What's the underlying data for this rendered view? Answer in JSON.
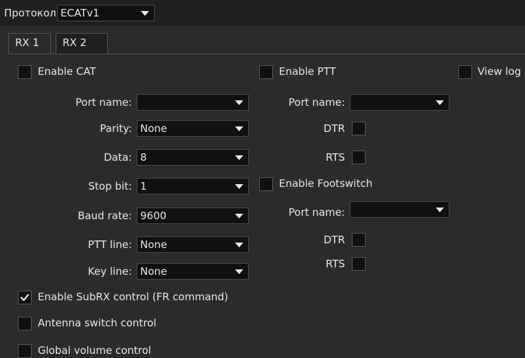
{
  "protocol": {
    "label": "Протокол:",
    "value": "ECATv1"
  },
  "tabs": [
    {
      "label": "RX 1"
    },
    {
      "label": "RX 2"
    }
  ],
  "cat": {
    "enable_label": "Enable CAT",
    "enabled": false,
    "fields": [
      {
        "label": "Port name:",
        "value": ""
      },
      {
        "label": "Parity:",
        "value": "None"
      },
      {
        "label": "Data:",
        "value": "8"
      },
      {
        "label": "Stop bit:",
        "value": "1"
      },
      {
        "label": "Baud rate:",
        "value": "9600"
      },
      {
        "label": "PTT line:",
        "value": "None"
      },
      {
        "label": "Key line:",
        "value": "None"
      }
    ]
  },
  "ptt": {
    "enable_label": "Enable PTT",
    "enabled": false,
    "port_label": "Port name:",
    "port_value": "",
    "dtr_label": "DTR",
    "rts_label": "RTS"
  },
  "footswitch": {
    "enable_label": "Enable Footswitch",
    "enabled": false,
    "port_label": "Port name:",
    "port_value": "",
    "dtr_label": "DTR",
    "rts_label": "RTS"
  },
  "view_log": {
    "label": "View log"
  },
  "options": [
    {
      "label": "Enable SubRX control (FR command)",
      "checked": true
    },
    {
      "label": "Antenna switch control",
      "checked": false
    },
    {
      "label": "Global volume control",
      "checked": false
    }
  ]
}
